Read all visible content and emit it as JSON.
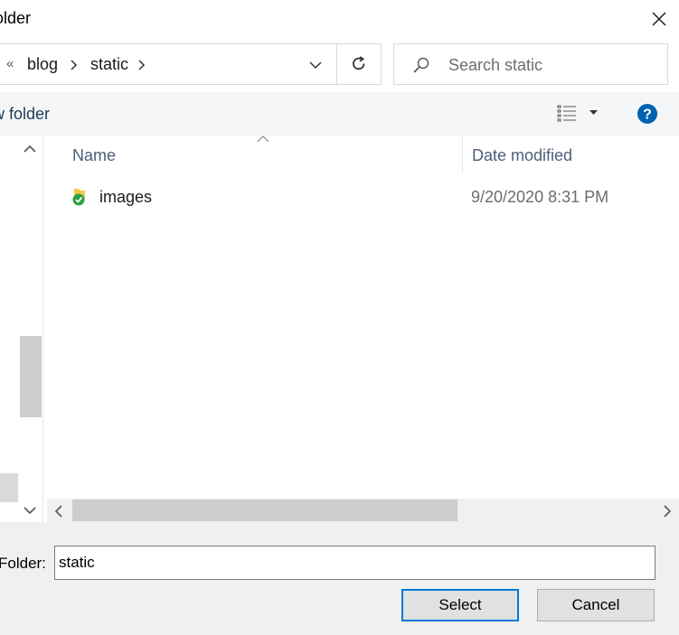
{
  "window": {
    "title": "older"
  },
  "address": {
    "overflow_glyph": "«",
    "crumbs": [
      "blog",
      "static"
    ]
  },
  "search": {
    "placeholder": "Search static"
  },
  "toolbar": {
    "new_folder": "w folder"
  },
  "columns": {
    "name": "Name",
    "date_modified": "Date modified"
  },
  "files": [
    {
      "name": "images",
      "date_modified": "9/20/2020 8:31 PM",
      "icon": "folder-synced-icon"
    }
  ],
  "footer": {
    "folder_label": "Folder:",
    "folder_value": "static",
    "select_label": "Select",
    "cancel_label": "Cancel"
  },
  "colors": {
    "accent": "#0078d7",
    "help": "#0063b1",
    "sync_green": "#2ea043"
  }
}
